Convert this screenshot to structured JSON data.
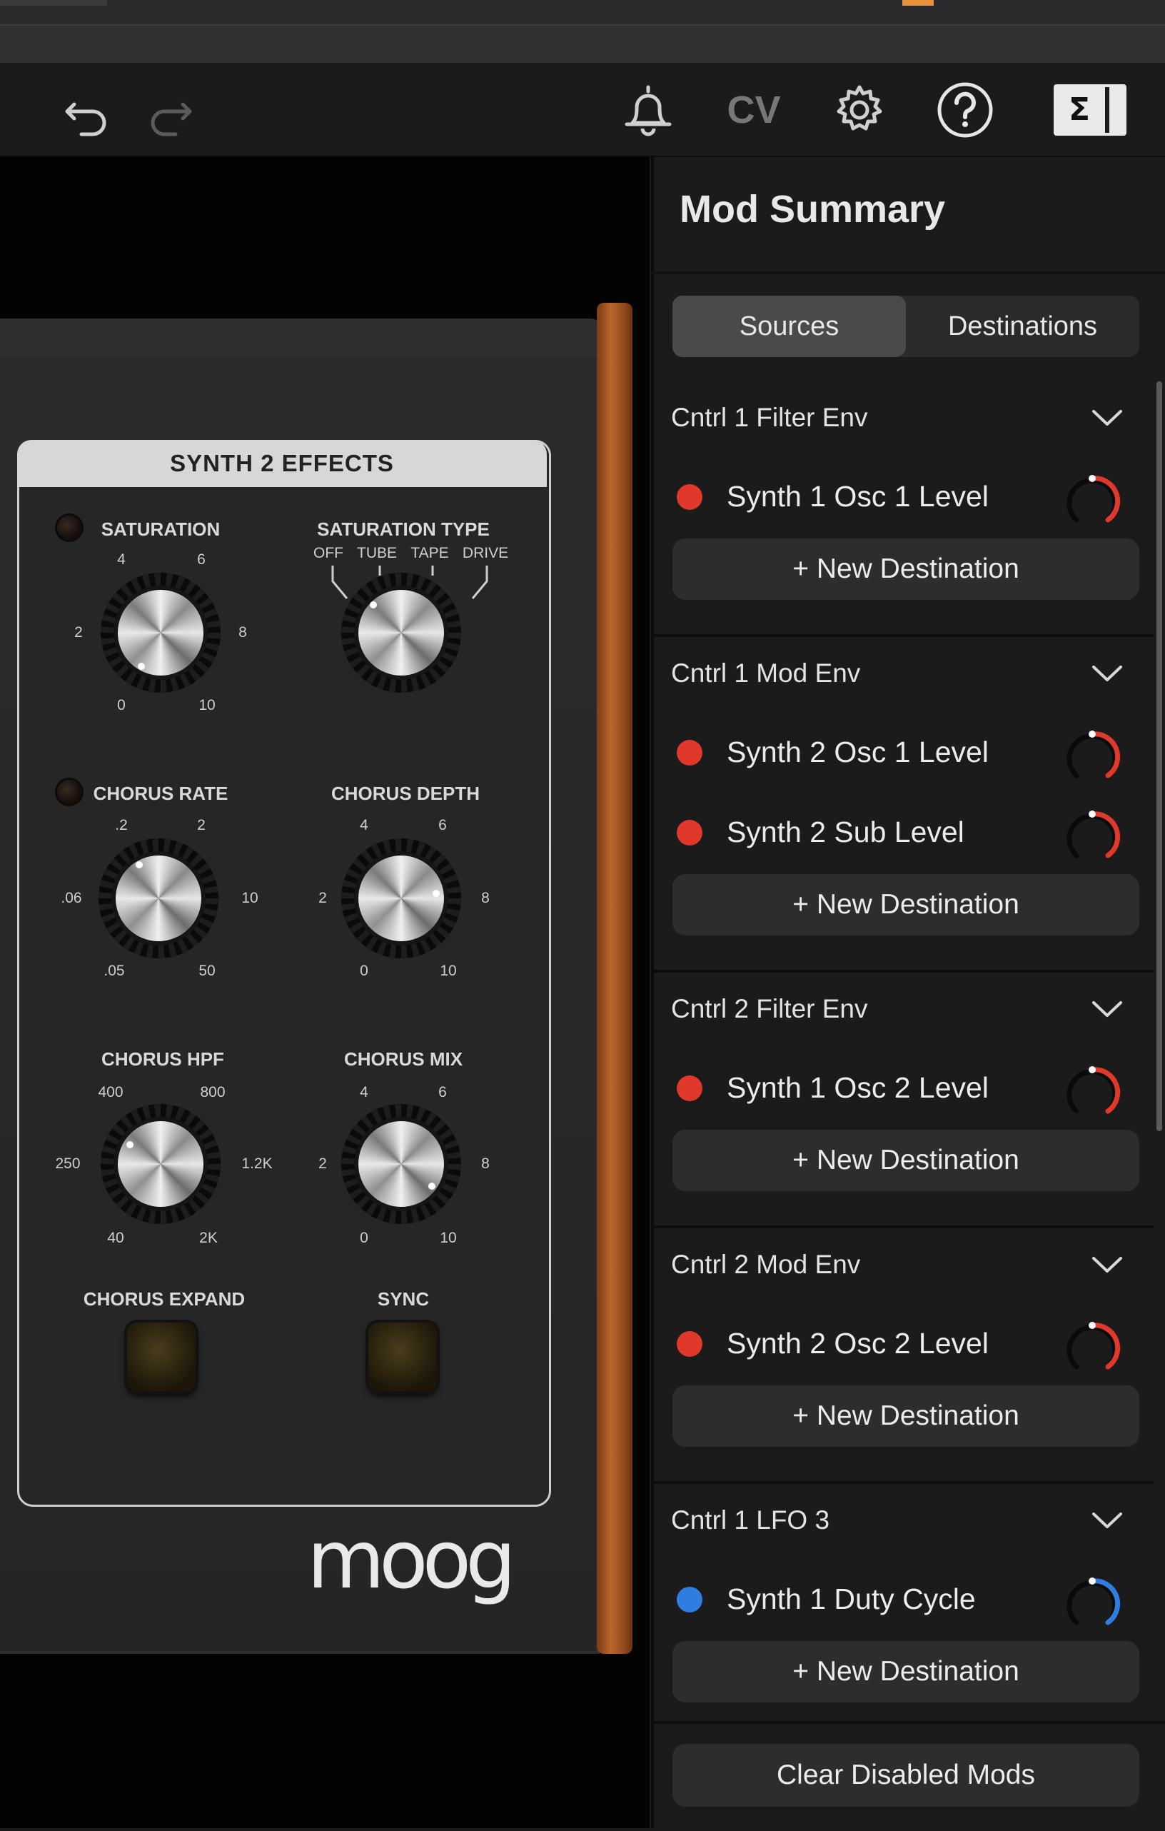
{
  "toolbar": {
    "icons": [
      "undo-icon",
      "redo-icon",
      "bell-icon",
      "cv-icon",
      "gear-icon",
      "help-icon",
      "sigma-panel-icon"
    ],
    "cv_label": "CV",
    "sigma_label": "Σ"
  },
  "synth": {
    "effects_title": "SYNTH 2 EFFECTS",
    "saturation": {
      "label": "SATURATION",
      "ticks": [
        "0",
        "2",
        "4",
        "6",
        "8",
        "10"
      ]
    },
    "saturation_type": {
      "label": "SATURATION TYPE",
      "options": [
        "OFF",
        "TUBE",
        "TAPE",
        "DRIVE"
      ]
    },
    "chorus_rate": {
      "label": "CHORUS RATE",
      "ticks": [
        ".05",
        ".06",
        ".2",
        "2",
        "10",
        "50"
      ]
    },
    "chorus_depth": {
      "label": "CHORUS DEPTH",
      "ticks": [
        "0",
        "2",
        "4",
        "6",
        "8",
        "10"
      ]
    },
    "chorus_hpf": {
      "label": "CHORUS HPF",
      "ticks": [
        "40",
        "250",
        "400",
        "800",
        "1.2K",
        "2K"
      ]
    },
    "chorus_mix": {
      "label": "CHORUS MIX",
      "ticks": [
        "0",
        "2",
        "4",
        "6",
        "8",
        "10"
      ]
    },
    "chorus_expand": {
      "label": "CHORUS EXPAND"
    },
    "sync": {
      "label": "SYNC"
    },
    "brand": "moog"
  },
  "mod_summary": {
    "title": "Mod Summary",
    "tabs": [
      {
        "label": "Sources",
        "selected": true
      },
      {
        "label": "Destinations",
        "selected": false
      }
    ],
    "new_destination_label": "+ New Destination",
    "groups": [
      {
        "source": "Cntrl 1 Filter Env",
        "destinations": [
          {
            "name": "Synth 1 Osc 1 Level",
            "color": "#e0392b"
          }
        ]
      },
      {
        "source": "Cntrl 1 Mod Env",
        "destinations": [
          {
            "name": "Synth 2 Osc 1 Level",
            "color": "#e0392b"
          },
          {
            "name": "Synth 2 Sub Level",
            "color": "#e0392b"
          }
        ]
      },
      {
        "source": "Cntrl 2 Filter Env",
        "destinations": [
          {
            "name": "Synth 1 Osc 2 Level",
            "color": "#e0392b"
          }
        ]
      },
      {
        "source": "Cntrl 2 Mod Env",
        "destinations": [
          {
            "name": "Synth 2 Osc 2 Level",
            "color": "#e0392b"
          }
        ]
      },
      {
        "source": "Cntrl 1 LFO 3",
        "destinations": [
          {
            "name": "Synth 1 Duty Cycle",
            "color": "#2f7de1"
          }
        ]
      }
    ],
    "clear_button": "Clear Disabled Mods"
  }
}
